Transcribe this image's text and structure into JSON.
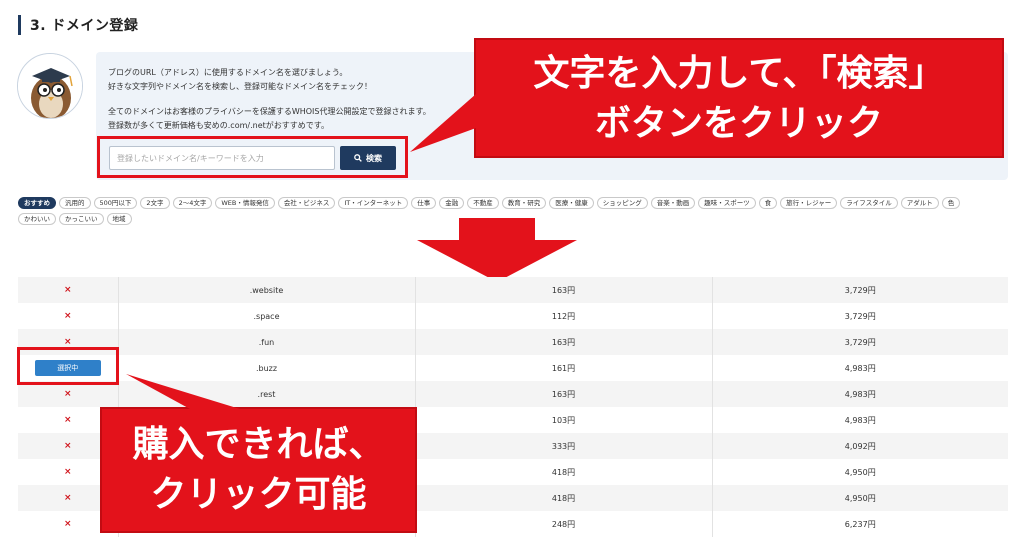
{
  "section": {
    "title": "3. ドメイン登録"
  },
  "info": {
    "line1": "ブログのURL（アドレス）に使用するドメイン名を選びましょう。",
    "line2": "好きな文字列やドメイン名を検索し、登録可能なドメイン名をチェック！",
    "line3": "全てのドメインはお客様のプライバシーを保護するWHOIS代理公開設定で登録されます。",
    "line4": "登録数が多くて更新価格も安めの.com/.netがおすすめです。"
  },
  "search": {
    "placeholder": "登録したいドメイン名/キーワードを入力",
    "button_label": "検索"
  },
  "tags": [
    "おすすめ",
    "汎用的",
    "500円以下",
    "2文字",
    "2〜4文字",
    "WEB・情報発信",
    "会社・ビジネス",
    "IT・インターネット",
    "仕事",
    "金融",
    "不動産",
    "教育・研究",
    "医療・健康",
    "ショッピング",
    "音楽・動画",
    "趣味・スポーツ",
    "食",
    "旅行・レジャー",
    "ライフスタイル",
    "アダルト",
    "色",
    "かわいい",
    "かっこいい",
    "地域"
  ],
  "active_tag_index": 0,
  "callouts": {
    "top_line1": "文字を入力して、「検索」",
    "top_line2": "ボタンをクリック",
    "bottom_line1": "購入できれば、",
    "bottom_line2": "クリック可能"
  },
  "table": {
    "select_label": "選択中",
    "unavailable_mark": "×",
    "rows": [
      {
        "status": "x",
        "tld": ".website",
        "price1": "163円",
        "price2": "3,729円"
      },
      {
        "status": "x",
        "tld": ".space",
        "price1": "112円",
        "price2": "3,729円"
      },
      {
        "status": "x",
        "tld": ".fun",
        "price1": "163円",
        "price2": "3,729円"
      },
      {
        "status": "select",
        "tld": ".buzz",
        "price1": "161円",
        "price2": "4,983円"
      },
      {
        "status": "x",
        "tld": ".rest",
        "price1": "163円",
        "price2": "4,983円"
      },
      {
        "status": "x",
        "tld": "",
        "price1": "103円",
        "price2": "4,983円"
      },
      {
        "status": "x",
        "tld": "",
        "price1": "333円",
        "price2": "4,092円"
      },
      {
        "status": "x",
        "tld": "",
        "price1": "418円",
        "price2": "4,950円"
      },
      {
        "status": "x",
        "tld": "",
        "price1": "418円",
        "price2": "4,950円"
      },
      {
        "status": "x",
        "tld": "",
        "price1": "248円",
        "price2": "6,237円"
      }
    ]
  },
  "colors": {
    "accent_red": "#e3121b",
    "navy": "#1f3a5f",
    "link_blue": "#2f80c9"
  },
  "icons": {
    "search_button": "search-icon",
    "avatar": "owl-professor-icon",
    "arrow": "down-arrow-icon",
    "unavailable": "cross-icon"
  }
}
